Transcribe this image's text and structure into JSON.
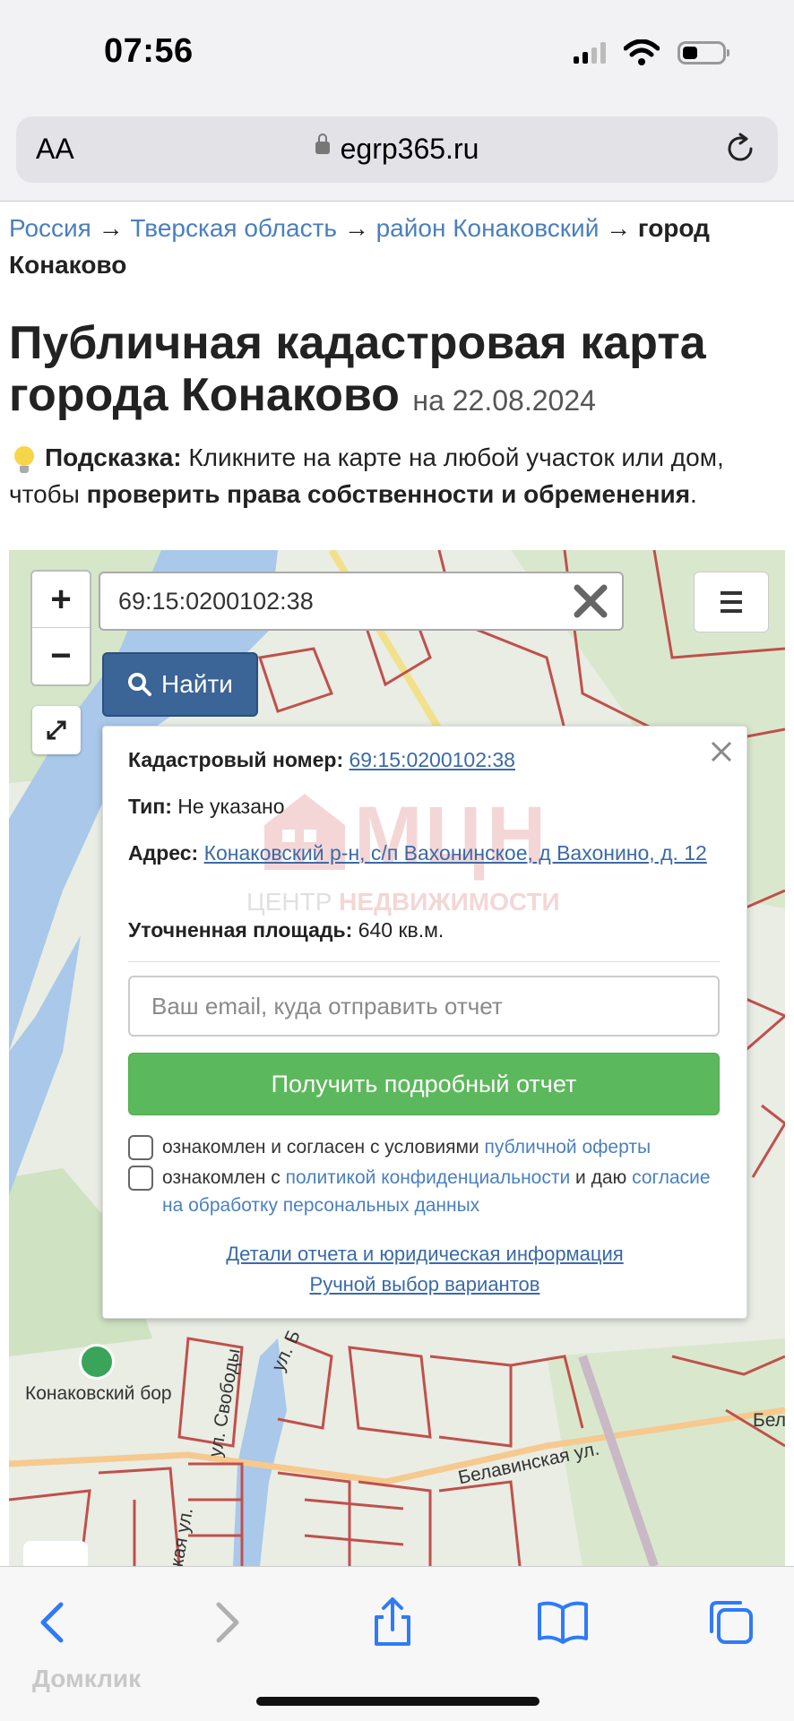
{
  "status_bar": {
    "time": "07:56"
  },
  "browser": {
    "text_size_label": "AA",
    "url": "egrp365.ru"
  },
  "breadcrumbs": {
    "items": [
      "Россия",
      "Тверская область",
      "район Конаковский"
    ],
    "separator": "→",
    "current": "город Конаково"
  },
  "page": {
    "title": "Публичная кадастровая карта города Конаково",
    "date_prefix": "на",
    "date": "22.08.2024"
  },
  "hint": {
    "label": "Подсказка:",
    "text": "Кликните на карте на любой участок или дом, чтобы",
    "bold_text": "проверить права собственности и обременения",
    "end": "."
  },
  "map": {
    "zoom_in": "+",
    "zoom_out": "−",
    "search_value": "69:15:0200102:38",
    "find_label": "Найти",
    "labels": {
      "forest": "Конаковский бор",
      "street_belavinskaya": "Белавинская ул.",
      "street_svobody": "ул. Свободы",
      "street_b": "ул. Б",
      "street_kaya": "кая ул.",
      "edge_bel": "Бел"
    }
  },
  "popup": {
    "cadastral_label": "Кадастровый номер:",
    "cadastral_value": "69:15:0200102:38",
    "type_label": "Тип:",
    "type_value": "Не указано",
    "address_label": "Адрес:",
    "address_value": "Конаковский р-н, с/п Вахонинское, д Вахонино, д. 12",
    "area_label": "Уточненная площадь:",
    "area_value": "640 кв.м.",
    "email_placeholder": "Ваш email, куда отправить отчет",
    "report_button": "Получить подробный отчет",
    "consent1_text": "ознакомлен и согласен с условиями",
    "consent1_link": "публичной оферты",
    "consent2_text_a": "ознакомлен с",
    "consent2_link1": "политикой конфиденциальности",
    "consent2_text_b": "и даю",
    "consent2_link2": "согласие на обработку персональных данных",
    "details_link": "Детали отчета и юридическая информация",
    "manual_link": "Ручной выбор вариантов",
    "watermark_big": "МЦН",
    "watermark_small_a": "ЦЕНТР",
    "watermark_small_b": "НЕДВИЖИМОСТИ"
  },
  "footer_watermark": "Домклик",
  "colors": {
    "link": "#4a7fbf",
    "find_button": "#3b6497",
    "report_button": "#5cb85c",
    "parcel_border": "#c0504d",
    "water": "#a9c8ea"
  }
}
